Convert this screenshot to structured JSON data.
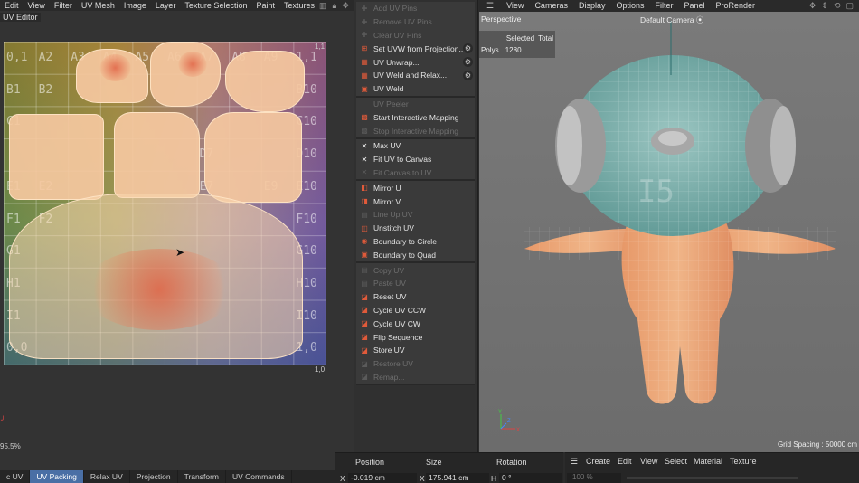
{
  "uv_editor": {
    "menu": [
      "Edit",
      "View",
      "Filter",
      "UV Mesh",
      "Image",
      "Layer",
      "Texture Selection",
      "Paint",
      "Textures"
    ],
    "title": "UV Editor",
    "corner_top_right": "1,1",
    "corner_bottom_right": "1,0",
    "zoom": "95.5%",
    "cell_labels": [
      [
        "0,1",
        "A2",
        "A3",
        "A4",
        "A5",
        "A6",
        "A7",
        "A8",
        "A9",
        "1,1"
      ],
      [
        "B1",
        "B2",
        "",
        "",
        "",
        "",
        "",
        "",
        "",
        "B10"
      ],
      [
        "C1",
        "",
        "",
        "",
        "",
        "",
        "",
        "",
        "",
        "C10"
      ],
      [
        "",
        "",
        "",
        "",
        "",
        "",
        "D7",
        "",
        "",
        "D10"
      ],
      [
        "E1",
        "E2",
        "",
        "",
        "",
        "",
        "E7",
        "",
        "E9",
        "E10"
      ],
      [
        "F1",
        "F2",
        "",
        "",
        "",
        "",
        "",
        "",
        "",
        "F10"
      ],
      [
        "G1",
        "",
        "",
        "",
        "",
        "",
        "",
        "",
        "",
        "G10"
      ],
      [
        "H1",
        "",
        "",
        "",
        "",
        "",
        "",
        "",
        "",
        "H10"
      ],
      [
        "I1",
        "",
        "",
        "",
        "",
        "",
        "",
        "",
        "",
        "I10"
      ],
      [
        "0,0",
        "",
        "",
        "",
        "",
        "",
        "",
        "",
        "",
        "1,0"
      ]
    ],
    "tabs": [
      {
        "label": "c UV",
        "active": false
      },
      {
        "label": "UV Packing",
        "active": true
      },
      {
        "label": "Relax UV",
        "active": false
      },
      {
        "label": "Projection",
        "active": false
      },
      {
        "label": "Transform",
        "active": false
      },
      {
        "label": "UV Commands",
        "active": false
      }
    ]
  },
  "commands": {
    "groups": [
      [
        {
          "label": "Add UV Pins",
          "enabled": false,
          "icon": "pin-icon",
          "gear": false
        },
        {
          "label": "Remove UV Pins",
          "enabled": false,
          "icon": "pin-remove-icon",
          "gear": false
        },
        {
          "label": "Clear UV Pins",
          "enabled": false,
          "icon": "pin-clear-icon",
          "gear": false
        },
        {
          "label": "Set UVW from Projection...",
          "enabled": true,
          "icon": "projection-icon",
          "gear": true
        },
        {
          "label": "UV Unwrap...",
          "enabled": true,
          "icon": "unwrap-icon",
          "gear": true
        },
        {
          "label": "UV Weld and Relax...",
          "enabled": true,
          "icon": "weld-relax-icon",
          "gear": true
        },
        {
          "label": "UV Weld",
          "enabled": true,
          "icon": "weld-icon",
          "gear": false
        }
      ],
      [
        {
          "label": "UV Peeler",
          "enabled": false,
          "icon": "",
          "gear": false
        },
        {
          "label": "Start Interactive Mapping",
          "enabled": true,
          "icon": "interactive-mapping-icon",
          "gear": false
        },
        {
          "label": "Stop Interactive Mapping",
          "enabled": false,
          "icon": "interactive-mapping-icon",
          "gear": false
        }
      ],
      [
        {
          "label": "Max UV",
          "enabled": true,
          "icon": "max-uv-icon",
          "gear": false
        },
        {
          "label": "Fit UV to Canvas",
          "enabled": true,
          "icon": "fit-canvas-icon",
          "gear": false
        },
        {
          "label": "Fit Canvas to UV",
          "enabled": false,
          "icon": "fit-uv-icon",
          "gear": false
        }
      ],
      [
        {
          "label": "Mirror U",
          "enabled": true,
          "icon": "mirror-u-icon",
          "gear": false
        },
        {
          "label": "Mirror V",
          "enabled": true,
          "icon": "mirror-v-icon",
          "gear": false
        },
        {
          "label": "Line Up UV",
          "enabled": false,
          "icon": "line-up-icon",
          "gear": false
        },
        {
          "label": "Unstitch UV",
          "enabled": true,
          "icon": "unstitch-icon",
          "gear": false
        },
        {
          "label": "Boundary to Circle",
          "enabled": true,
          "icon": "boundary-circle-icon",
          "gear": false
        },
        {
          "label": "Boundary to Quad",
          "enabled": true,
          "icon": "boundary-quad-icon",
          "gear": false
        }
      ],
      [
        {
          "label": "Copy UV",
          "enabled": false,
          "icon": "copy-icon",
          "gear": false
        },
        {
          "label": "Paste UV",
          "enabled": false,
          "icon": "paste-icon",
          "gear": false
        },
        {
          "label": "Reset UV",
          "enabled": true,
          "icon": "reset-icon",
          "gear": false
        },
        {
          "label": "Cycle UV CCW",
          "enabled": true,
          "icon": "cycle-ccw-icon",
          "gear": false
        },
        {
          "label": "Cycle UV CW",
          "enabled": true,
          "icon": "cycle-cw-icon",
          "gear": false
        },
        {
          "label": "Flip Sequence",
          "enabled": true,
          "icon": "flip-sequence-icon",
          "gear": false
        },
        {
          "label": "Store UV",
          "enabled": true,
          "icon": "store-icon",
          "gear": false
        },
        {
          "label": "Restore UV",
          "enabled": false,
          "icon": "restore-icon",
          "gear": false
        },
        {
          "label": "Remap...",
          "enabled": false,
          "icon": "remap-icon",
          "gear": false
        }
      ]
    ]
  },
  "viewport": {
    "menu": [
      "View",
      "Cameras",
      "Display",
      "Options",
      "Filter",
      "Panel",
      "ProRender"
    ],
    "view_name": "Perspective",
    "camera": "Default Camera",
    "stats": {
      "selected_header": "Selected",
      "total_header": "Total",
      "row_label": "Polys",
      "selected_value": "1280",
      "total_value": ""
    },
    "grid_spacing": "Grid Spacing : 50000 cm",
    "axis_labels": {
      "x": "X",
      "y": "Y",
      "z": "Z"
    }
  },
  "coordinates": {
    "position_header": "Position",
    "size_header": "Size",
    "rotation_header": "Rotation",
    "x_label": "X",
    "position_x": "-0.019 cm",
    "size_x": "175.941 cm",
    "h_label": "H",
    "rotation_h": "0 °"
  },
  "material_manager": {
    "menu": [
      "Create",
      "Edit",
      "View",
      "Select",
      "Material",
      "Texture"
    ],
    "zoom": "100 %"
  },
  "colors": {
    "active_tab": "#4a6fa5",
    "uv_shell": "#f5c8a0",
    "mesh_teal": "#7fb3b0",
    "mesh_skin": "#e8a070"
  }
}
